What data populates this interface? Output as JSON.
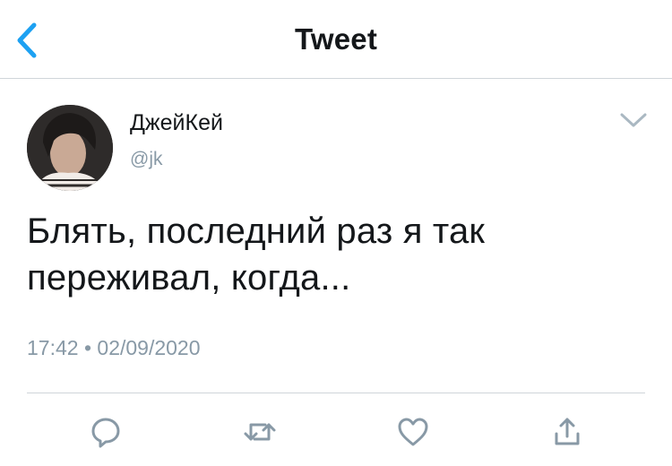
{
  "header": {
    "title": "Tweet",
    "back_icon": "chevron-left-icon"
  },
  "tweet": {
    "author_name": "ДжейКей",
    "author_handle": "@jk",
    "text": "Блять, последний раз я так переживал, когда...",
    "time": "17:42",
    "separator": "•",
    "date": "02/09/2020",
    "menu_icon": "chevron-down-icon"
  },
  "actions": [
    {
      "name": "reply",
      "icon": "reply-icon"
    },
    {
      "name": "retweet",
      "icon": "retweet-icon"
    },
    {
      "name": "like",
      "icon": "heart-icon"
    },
    {
      "name": "share",
      "icon": "share-icon"
    }
  ],
  "colors": {
    "accent": "#1da1f2",
    "secondary_text": "#8899a6",
    "divider": "#d0d5da"
  }
}
